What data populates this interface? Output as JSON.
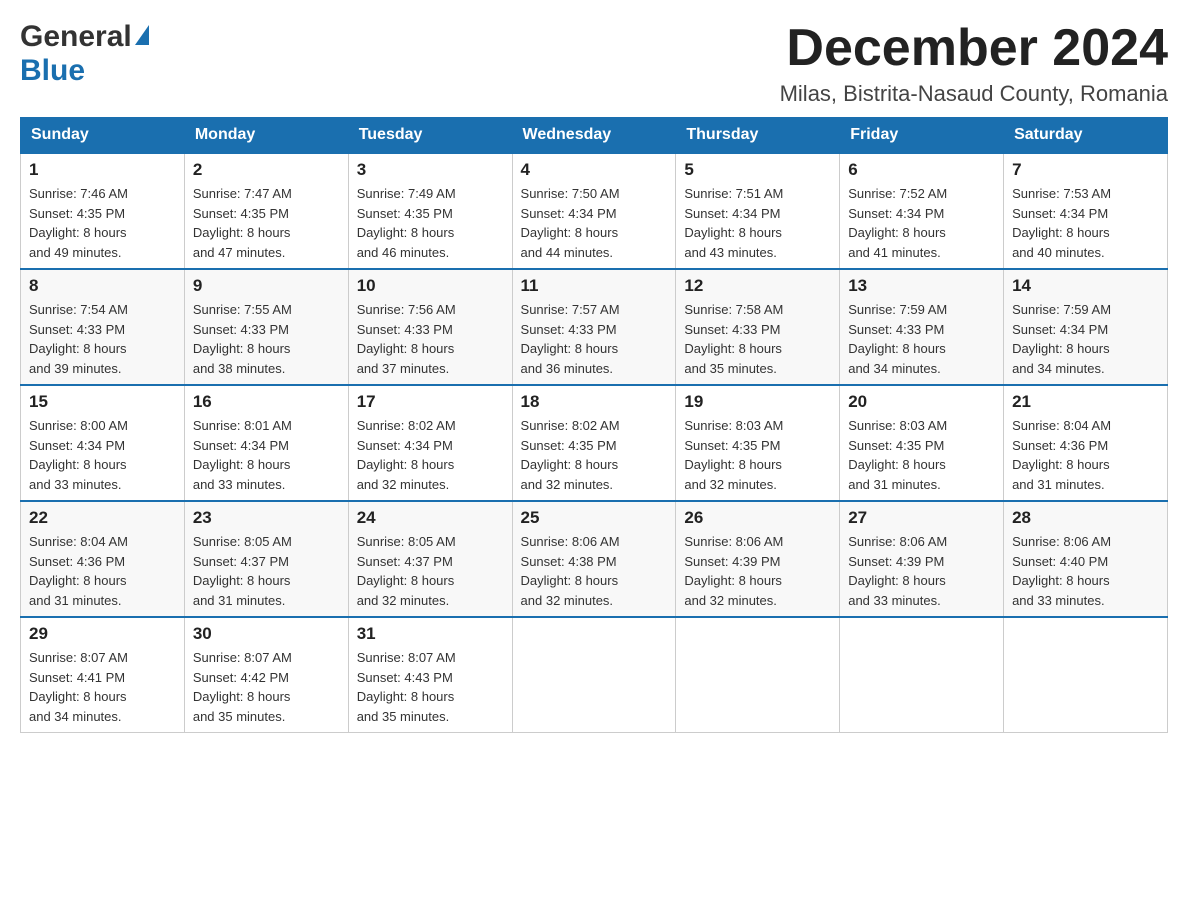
{
  "header": {
    "logo_general": "General",
    "logo_blue": "Blue",
    "month_title": "December 2024",
    "location": "Milas, Bistrita-Nasaud County, Romania"
  },
  "days_of_week": [
    "Sunday",
    "Monday",
    "Tuesday",
    "Wednesday",
    "Thursday",
    "Friday",
    "Saturday"
  ],
  "weeks": [
    [
      {
        "day": "1",
        "sunrise": "7:46 AM",
        "sunset": "4:35 PM",
        "daylight": "8 hours and 49 minutes."
      },
      {
        "day": "2",
        "sunrise": "7:47 AM",
        "sunset": "4:35 PM",
        "daylight": "8 hours and 47 minutes."
      },
      {
        "day": "3",
        "sunrise": "7:49 AM",
        "sunset": "4:35 PM",
        "daylight": "8 hours and 46 minutes."
      },
      {
        "day": "4",
        "sunrise": "7:50 AM",
        "sunset": "4:34 PM",
        "daylight": "8 hours and 44 minutes."
      },
      {
        "day": "5",
        "sunrise": "7:51 AM",
        "sunset": "4:34 PM",
        "daylight": "8 hours and 43 minutes."
      },
      {
        "day": "6",
        "sunrise": "7:52 AM",
        "sunset": "4:34 PM",
        "daylight": "8 hours and 41 minutes."
      },
      {
        "day": "7",
        "sunrise": "7:53 AM",
        "sunset": "4:34 PM",
        "daylight": "8 hours and 40 minutes."
      }
    ],
    [
      {
        "day": "8",
        "sunrise": "7:54 AM",
        "sunset": "4:33 PM",
        "daylight": "8 hours and 39 minutes."
      },
      {
        "day": "9",
        "sunrise": "7:55 AM",
        "sunset": "4:33 PM",
        "daylight": "8 hours and 38 minutes."
      },
      {
        "day": "10",
        "sunrise": "7:56 AM",
        "sunset": "4:33 PM",
        "daylight": "8 hours and 37 minutes."
      },
      {
        "day": "11",
        "sunrise": "7:57 AM",
        "sunset": "4:33 PM",
        "daylight": "8 hours and 36 minutes."
      },
      {
        "day": "12",
        "sunrise": "7:58 AM",
        "sunset": "4:33 PM",
        "daylight": "8 hours and 35 minutes."
      },
      {
        "day": "13",
        "sunrise": "7:59 AM",
        "sunset": "4:33 PM",
        "daylight": "8 hours and 34 minutes."
      },
      {
        "day": "14",
        "sunrise": "7:59 AM",
        "sunset": "4:34 PM",
        "daylight": "8 hours and 34 minutes."
      }
    ],
    [
      {
        "day": "15",
        "sunrise": "8:00 AM",
        "sunset": "4:34 PM",
        "daylight": "8 hours and 33 minutes."
      },
      {
        "day": "16",
        "sunrise": "8:01 AM",
        "sunset": "4:34 PM",
        "daylight": "8 hours and 33 minutes."
      },
      {
        "day": "17",
        "sunrise": "8:02 AM",
        "sunset": "4:34 PM",
        "daylight": "8 hours and 32 minutes."
      },
      {
        "day": "18",
        "sunrise": "8:02 AM",
        "sunset": "4:35 PM",
        "daylight": "8 hours and 32 minutes."
      },
      {
        "day": "19",
        "sunrise": "8:03 AM",
        "sunset": "4:35 PM",
        "daylight": "8 hours and 32 minutes."
      },
      {
        "day": "20",
        "sunrise": "8:03 AM",
        "sunset": "4:35 PM",
        "daylight": "8 hours and 31 minutes."
      },
      {
        "day": "21",
        "sunrise": "8:04 AM",
        "sunset": "4:36 PM",
        "daylight": "8 hours and 31 minutes."
      }
    ],
    [
      {
        "day": "22",
        "sunrise": "8:04 AM",
        "sunset": "4:36 PM",
        "daylight": "8 hours and 31 minutes."
      },
      {
        "day": "23",
        "sunrise": "8:05 AM",
        "sunset": "4:37 PM",
        "daylight": "8 hours and 31 minutes."
      },
      {
        "day": "24",
        "sunrise": "8:05 AM",
        "sunset": "4:37 PM",
        "daylight": "8 hours and 32 minutes."
      },
      {
        "day": "25",
        "sunrise": "8:06 AM",
        "sunset": "4:38 PM",
        "daylight": "8 hours and 32 minutes."
      },
      {
        "day": "26",
        "sunrise": "8:06 AM",
        "sunset": "4:39 PM",
        "daylight": "8 hours and 32 minutes."
      },
      {
        "day": "27",
        "sunrise": "8:06 AM",
        "sunset": "4:39 PM",
        "daylight": "8 hours and 33 minutes."
      },
      {
        "day": "28",
        "sunrise": "8:06 AM",
        "sunset": "4:40 PM",
        "daylight": "8 hours and 33 minutes."
      }
    ],
    [
      {
        "day": "29",
        "sunrise": "8:07 AM",
        "sunset": "4:41 PM",
        "daylight": "8 hours and 34 minutes."
      },
      {
        "day": "30",
        "sunrise": "8:07 AM",
        "sunset": "4:42 PM",
        "daylight": "8 hours and 35 minutes."
      },
      {
        "day": "31",
        "sunrise": "8:07 AM",
        "sunset": "4:43 PM",
        "daylight": "8 hours and 35 minutes."
      },
      null,
      null,
      null,
      null
    ]
  ],
  "labels": {
    "sunrise": "Sunrise:",
    "sunset": "Sunset:",
    "daylight": "Daylight:"
  }
}
